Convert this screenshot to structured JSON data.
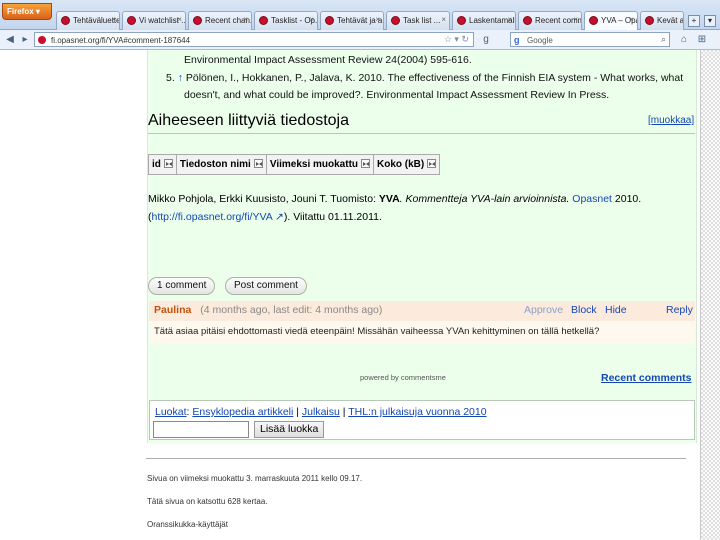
{
  "browser": {
    "menu_label": "Firefox",
    "tabs": [
      "Tehtäväluettelo ...",
      "Vi watchlist ...",
      "Recent chan...",
      "Tasklist - Op...",
      "Tehtävät ja a...",
      "Task list ...",
      "Laskentamalli ...",
      "Recent comm...",
      "YVA – Opas...",
      "Kevät artikk..."
    ],
    "url": "fi.opasnet.org/fi/YVA#comment-187644",
    "search_placeholder": "Google",
    "new_tab": "+"
  },
  "references": [
    {
      "num": "",
      "text": "Environmental Impact Assessment Review 24(2004) 595-616."
    },
    {
      "num": "5.",
      "arrow": "↑",
      "line1": "Pölönen, I., Hokkanen, P., Jalava, K. 2010. The effectiveness of the Finnish EIA system - What works, what",
      "line2": "doesn't, and what could be improved?. Environmental Impact Assessment Review In Press."
    }
  ],
  "section": {
    "title": "Aiheeseen liittyviä tiedostoja",
    "edit": "[muokkaa]"
  },
  "files_table": {
    "headers": [
      "id",
      "Tiedoston nimi",
      "Viimeksi muokattu",
      "Koko (kB)"
    ]
  },
  "citation": {
    "authors": "Mikko Pohjola, Erkki Kuusisto, Jouni T. Tuomisto: ",
    "title": "YVA",
    "subtitle": ". Kommentteja YVA-lain arvioinnista. ",
    "site": "Opasnet",
    "year": " 2010.",
    "link_open": "(",
    "url": "http://fi.opasnet.org/fi/YVA",
    "accessed": "). Viitattu 01.11.2011."
  },
  "comments": {
    "count_button": "1 comment",
    "post_button": "Post comment",
    "items": [
      {
        "author": "Paulina",
        "meta": "(4 months ago,   last edit: 4 months ago)",
        "approve": "Approve",
        "block": "Block",
        "hide": "Hide",
        "reply": "Reply",
        "text": "Tätä asiaa pitäisi ehdottomasti viedä eteenpäin! Missähän vaiheessa YVAn kehittyminen on tällä hetkellä?"
      }
    ],
    "powered": "powered by commentsme",
    "recent": "Recent comments"
  },
  "categories": {
    "label": "Luokat",
    "items": [
      "Ensyklopedia artikkeli",
      "Julkaisu",
      "THL:n julkaisuja vuonna 2010"
    ],
    "add_button": "Lisää luokka"
  },
  "footer": [
    "Sivua on viimeksi muokattu 3. marraskuuta 2011 kello 09.17.",
    "Tätä sivua on katsottu 628 kertaa.",
    "Oranssikukka-käyttäjät"
  ]
}
